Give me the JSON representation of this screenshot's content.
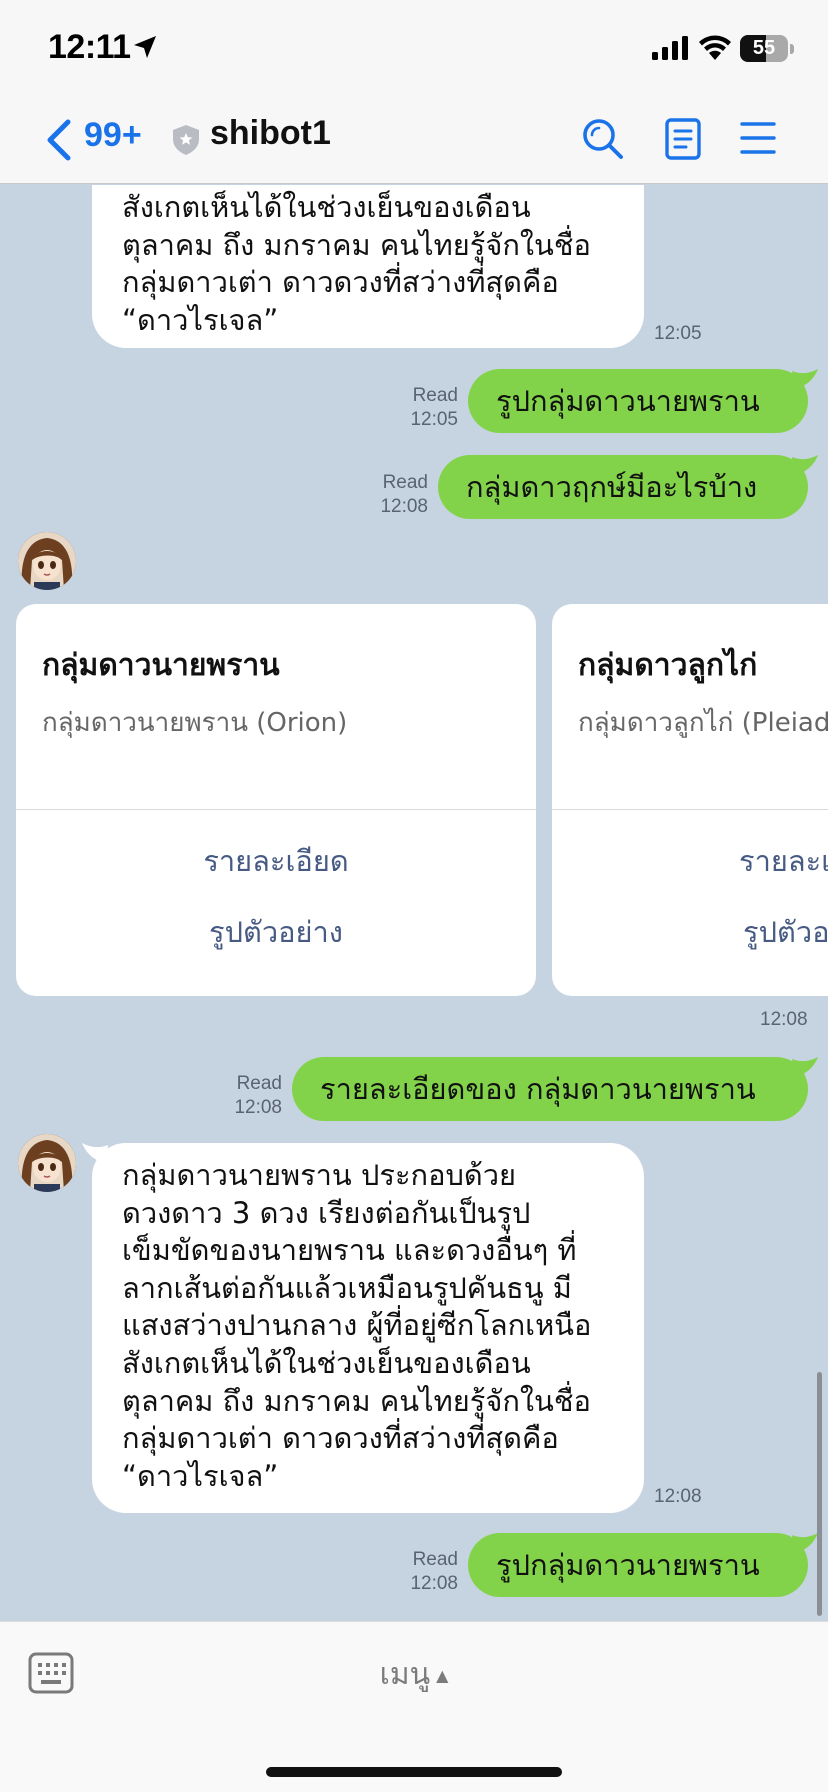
{
  "status_bar": {
    "time": "12:11",
    "battery": "55",
    "battery_level": 0.55
  },
  "header": {
    "back_count": "99+",
    "title": "shibot1"
  },
  "messages": {
    "m1_text": "สังเกตเห็นได้ในช่วงเย็นของเดือน\nตุลาคม ถึง มกราคม คนไทยรู้จักในชื่อ\nกลุ่มดาวเต่า ดาวดวงที่สว่างที่สุดคือ\n“ดาวไรเจล”",
    "m1_time": "12:05",
    "m2_text": "รูปกลุ่มดาวนายพราน",
    "m2_read": "Read",
    "m2_time": "12:05",
    "m3_text": "กลุ่มดาวฤกษ์มีอะไรบ้าง",
    "m3_read": "Read",
    "m3_time": "12:08",
    "carousel_time": "12:08",
    "m5_text": "รายละเอียดของ กลุ่มดาวนายพราน",
    "m5_read": "Read",
    "m5_time": "12:08",
    "m6_text": "กลุ่มดาวนายพราน ประกอบด้วย\nดวงดาว 3 ดวง เรียงต่อกันเป็นรูป\nเข็มขัดของนายพราน และดวงอื่นๆ ที่\nลากเส้นต่อกันแล้วเหมือนรูปคันธนู มี\nแสงสว่างปานกลาง ผู้ที่อยู่ซีกโลกเหนือ\nสังเกตเห็นได้ในช่วงเย็นของเดือน\nตุลาคม ถึง มกราคม คนไทยรู้จักในชื่อ\nกลุ่มดาวเต่า ดาวดวงที่สว่างที่สุดคือ\n“ดาวไรเจล”",
    "m6_time": "12:08",
    "m7_text": "รูปกลุ่มดาวนายพราน",
    "m7_read": "Read",
    "m7_time": "12:08"
  },
  "carousel": [
    {
      "title": "กลุ่มดาวนายพราน",
      "subtitle": "กลุ่มดาวนายพราน (Orion)",
      "action1": "รายละเอียด",
      "action2": "รูปตัวอย่าง"
    },
    {
      "title": "กลุ่มดาวลูกไก่",
      "subtitle": "กลุ่มดาวลูกไก่ (Pleiad",
      "action1": "รายละเ",
      "action2": "รูปตัวอ"
    }
  ],
  "bottom": {
    "menu_label": "เมนู",
    "menu_arrow": "▲"
  },
  "colors": {
    "chat_bg": "#c6d3e1",
    "outgoing": "#83d34a",
    "incoming": "#ffffff",
    "link": "#1a73e8",
    "card_action": "#465a83"
  }
}
